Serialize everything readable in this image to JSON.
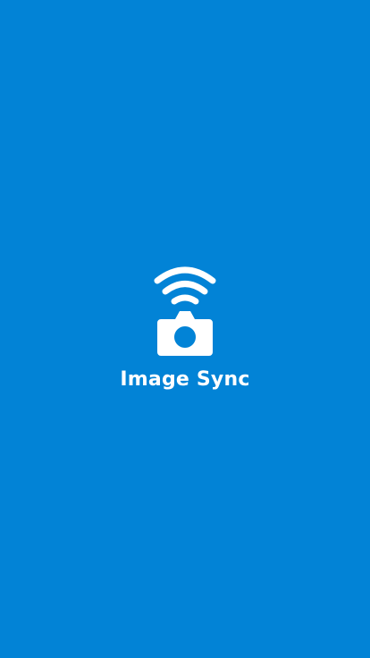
{
  "splash": {
    "app_name": "Image Sync"
  },
  "icons": {
    "logo": "wifi-camera-icon"
  },
  "colors": {
    "background": "#0283d6",
    "foreground": "#ffffff"
  }
}
